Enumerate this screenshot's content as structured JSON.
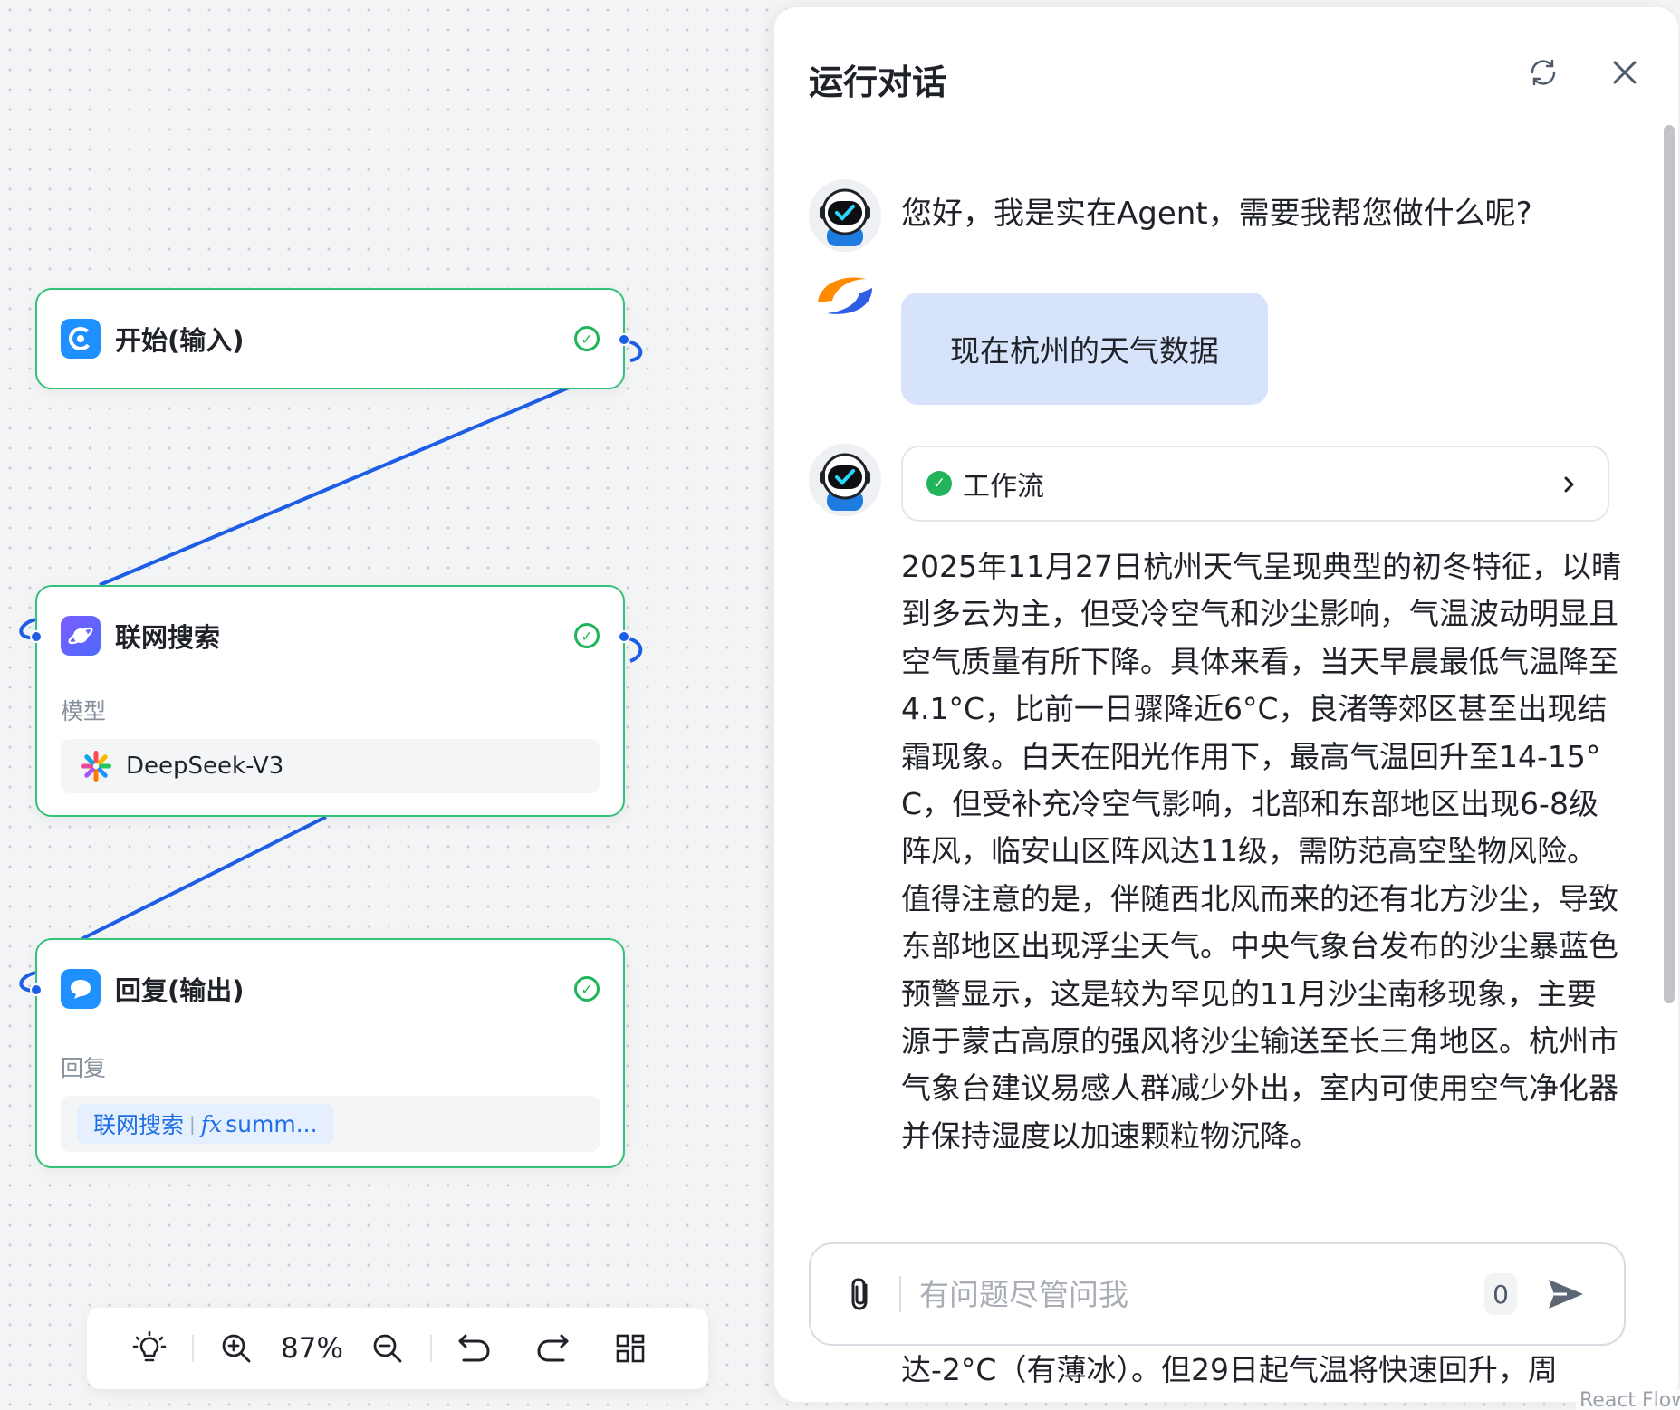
{
  "canvas": {
    "nodes": {
      "start": {
        "title": "开始(输入)"
      },
      "search": {
        "title": "联网搜索",
        "model_label": "模型",
        "model_name": "DeepSeek-V3"
      },
      "reply": {
        "title": "回复(输出)",
        "field_label": "回复",
        "ref_node": "联网搜索",
        "ref_var": "summ..."
      }
    },
    "toolbar": {
      "zoom": "87%"
    }
  },
  "chat": {
    "title": "运行对话",
    "greeting": "您好，我是实在Agent，需要我帮您做什么呢?",
    "user_message": "现在杭州的天气数据",
    "workflow_label": "工作流",
    "answer_paragraphs": [
      "2025年11月27日杭州天气呈现典型的初冬特征，以晴到多云为主，但受冷空气和沙尘影响，气温波动明显且空气质量有所下降。具体来看，当天早晨最低气温降至4.1°C，比前一日骤降近6°C，良渚等郊区甚至出现结霜现象。白天在阳光作用下，最高气温回升至14-15°C，但受补充冷空气影响，北部和东部地区出现6-8级阵风，临安山区阵风达11级，需防范高空坠物风险。",
      "值得注意的是，伴随西北风而来的还有北方沙尘，导致东部地区出现浮尘天气。中央气象台发布的沙尘暴蓝色预警显示，这是较为罕见的11月沙尘南移现象，主要源于蒙古高原的强风将沙尘输送至长三角地区。杭州市气象台建议易感人群减少外出，室内可使用空气净化器并保持湿度以加速颗粒物沉降。"
    ],
    "overflow_line": "达-2°C（有薄冰）。但29日起气温将快速回升，周",
    "input": {
      "placeholder": "有问题尽管问我",
      "count": "0"
    }
  },
  "attribution": "React Flow",
  "colors": {
    "node_border": "#34c27a",
    "edge": "#1e5ee6",
    "user_bubble": "#d7e2fb",
    "success": "#22b45a",
    "ref_chip_text": "#1e6fe6"
  }
}
